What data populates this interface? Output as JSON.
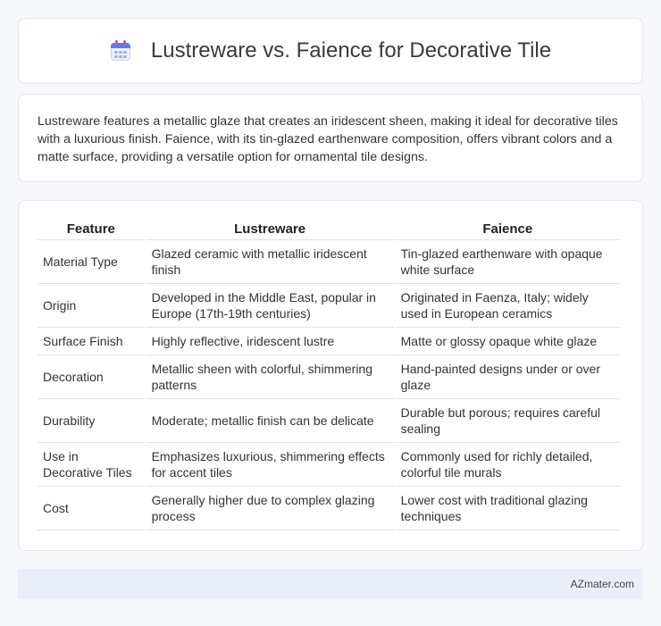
{
  "header": {
    "title": "Lustreware vs. Faience for Decorative Tile",
    "icon": "calendar-icon"
  },
  "intro": {
    "text": "Lustreware features a metallic glaze that creates an iridescent sheen, making it ideal for decorative tiles with a luxurious finish. Faience, with its tin-glazed earthenware composition, offers vibrant colors and a matte surface, providing a versatile option for ornamental tile designs."
  },
  "table": {
    "headers": [
      "Feature",
      "Lustreware",
      "Faience"
    ],
    "rows": [
      [
        "Material Type",
        "Glazed ceramic with metallic iridescent finish",
        "Tin-glazed earthenware with opaque white surface"
      ],
      [
        "Origin",
        "Developed in the Middle East, popular in Europe (17th-19th centuries)",
        "Originated in Faenza, Italy; widely used in European ceramics"
      ],
      [
        "Surface Finish",
        "Highly reflective, iridescent lustre",
        "Matte or glossy opaque white glaze"
      ],
      [
        "Decoration",
        "Metallic sheen with colorful, shimmering patterns",
        "Hand-painted designs under or over glaze"
      ],
      [
        "Durability",
        "Moderate; metallic finish can be delicate",
        "Durable but porous; requires careful sealing"
      ],
      [
        "Use in Decorative Tiles",
        "Emphasizes luxurious, shimmering effects for accent tiles",
        "Commonly used for richly detailed, colorful tile murals"
      ],
      [
        "Cost",
        "Generally higher due to complex glazing process",
        "Lower cost with traditional glazing techniques"
      ]
    ]
  },
  "footer": {
    "brand": "AZmater.com"
  }
}
